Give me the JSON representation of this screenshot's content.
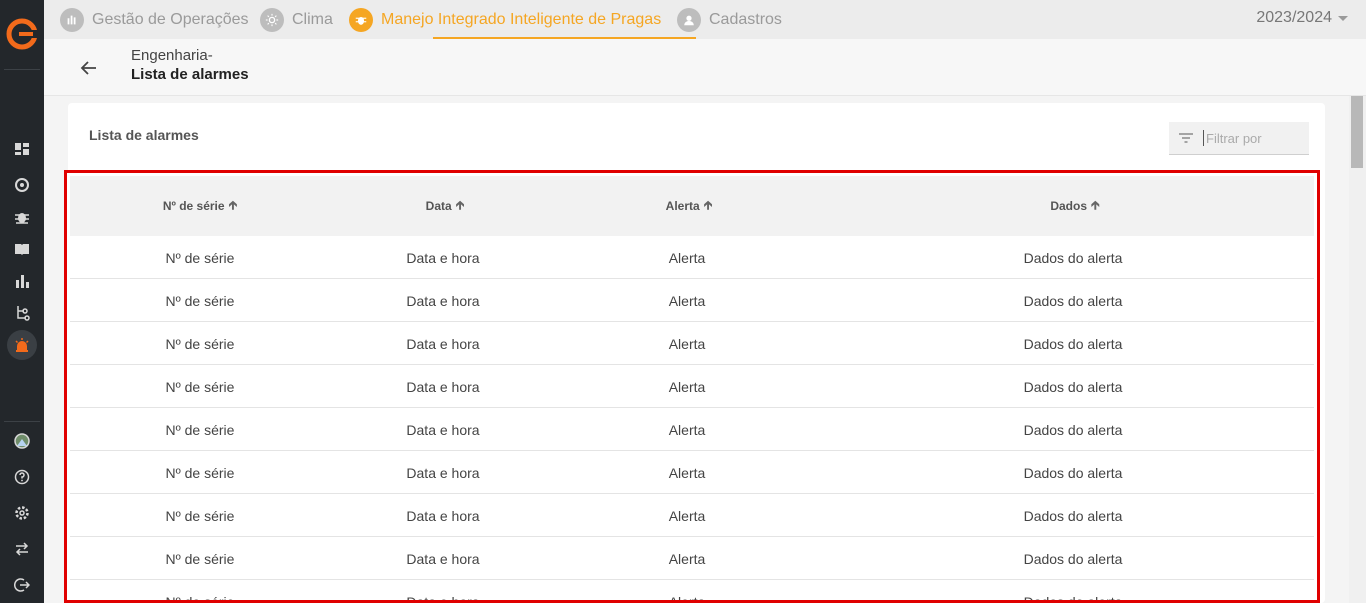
{
  "topbar": {
    "tabs": [
      {
        "label": "Gestão de Operações",
        "icon": "operations-icon"
      },
      {
        "label": "Clima",
        "icon": "sun-icon"
      },
      {
        "label": "Manejo Integrado Inteligente de Pragas",
        "icon": "bug-icon",
        "active": true
      },
      {
        "label": "Cadastros",
        "icon": "person-icon"
      }
    ],
    "season": "2023/2024"
  },
  "header": {
    "breadcrumb_parent": "Engenharia-",
    "page_title": "Lista de alarmes"
  },
  "card": {
    "title": "Lista de alarmes",
    "filter_placeholder": "Filtrar por"
  },
  "table": {
    "columns": [
      "Nº de série",
      "Data",
      "Alerta",
      "Dados"
    ],
    "rows": [
      [
        "Nº de série",
        "Data e hora",
        "Alerta",
        "Dados do alerta"
      ],
      [
        "Nº de série",
        "Data e hora",
        "Alerta",
        "Dados do alerta"
      ],
      [
        "Nº de série",
        "Data e hora",
        "Alerta",
        "Dados do alerta"
      ],
      [
        "Nº de série",
        "Data e hora",
        "Alerta",
        "Dados do alerta"
      ],
      [
        "Nº de série",
        "Data e hora",
        "Alerta",
        "Dados do alerta"
      ],
      [
        "Nº de série",
        "Data e hora",
        "Alerta",
        "Dados do alerta"
      ],
      [
        "Nº de série",
        "Data e hora",
        "Alerta",
        "Dados do alerta"
      ],
      [
        "Nº de série",
        "Data e hora",
        "Alerta",
        "Dados do alerta"
      ],
      [
        "Nº de série",
        "Data e hora",
        "Alerta",
        "Dados do alerta"
      ]
    ]
  },
  "colors": {
    "accent": "#f5a623",
    "sidebar": "#23272b",
    "highlight_border": "#e00000"
  }
}
